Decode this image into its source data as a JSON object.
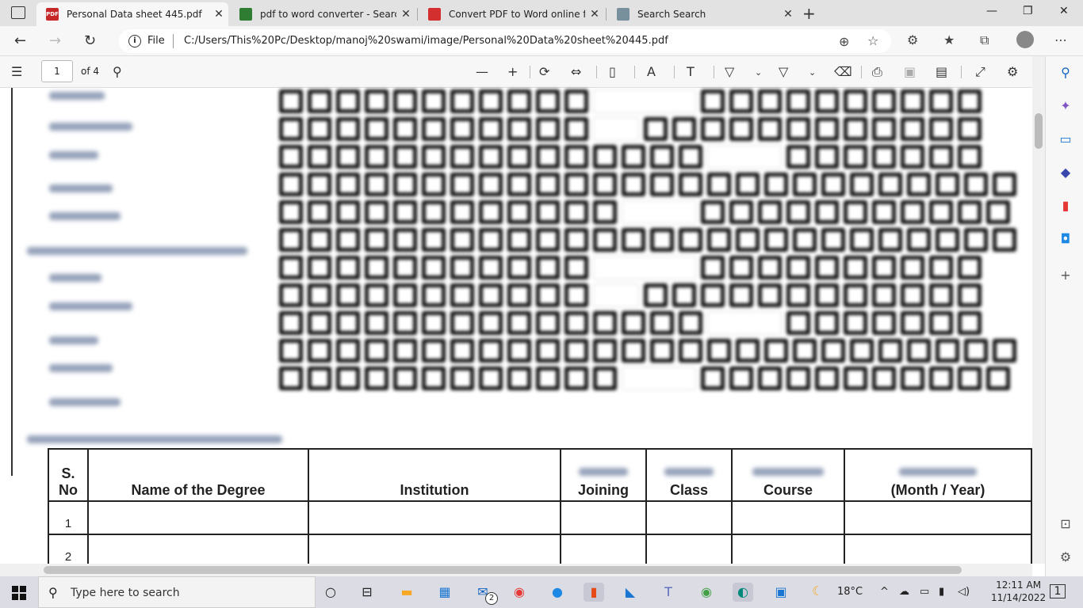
{
  "tabs": [
    {
      "title": "Personal Data sheet 445.pdf",
      "fav": "PDF",
      "color": "#c62828"
    },
    {
      "title": "pdf to word converter - Search",
      "fav": "",
      "color": "#2e7d32"
    },
    {
      "title": "Convert PDF to Word online for f",
      "fav": "",
      "color": "#d32f2f"
    },
    {
      "title": "Search Search",
      "fav": "",
      "color": "#78909c"
    }
  ],
  "address": {
    "scheme": "File",
    "url": "C:/Users/This%20Pc/Desktop/manoj%20swami/image/Personal%20Data%20sheet%20445.pdf"
  },
  "pdf": {
    "page": "1",
    "page_of": "of 4"
  },
  "table": {
    "headers": [
      "S. No",
      "Name of the Degree",
      "Institution",
      "Joining",
      "Class",
      "Course",
      "(Month / Year)"
    ],
    "rows": [
      [
        "1",
        "",
        "",
        "",
        "",
        "",
        ""
      ],
      [
        "2",
        "",
        "",
        "",
        "",
        "",
        ""
      ]
    ]
  },
  "taskbar": {
    "search_placeholder": "Type here to search",
    "badge": "2",
    "weather": "18°C",
    "time": "12:11 AM",
    "date": "11/14/2022",
    "notif": "1"
  }
}
